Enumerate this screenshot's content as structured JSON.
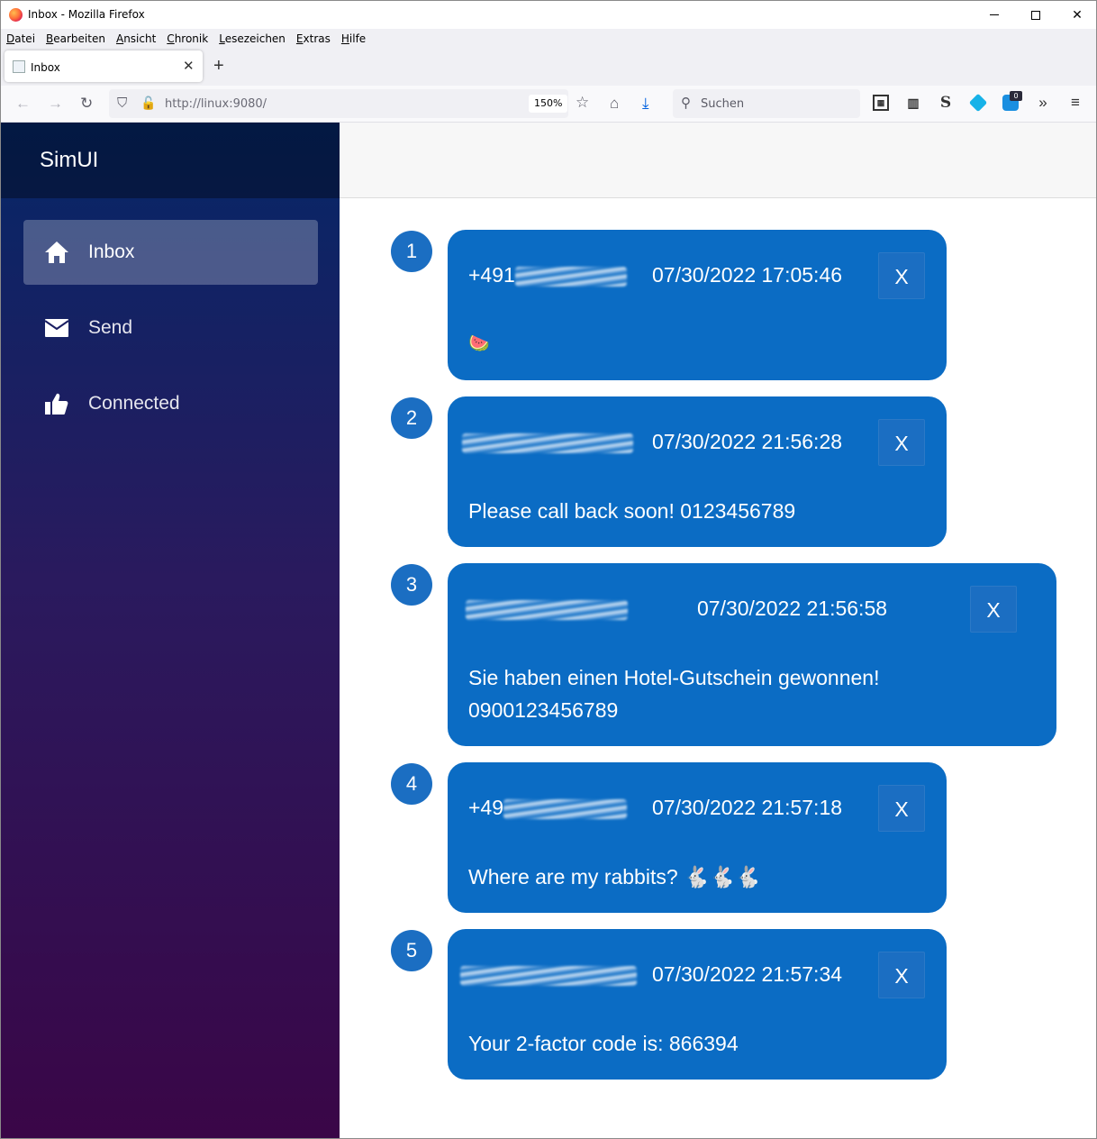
{
  "window": {
    "title": "Inbox - Mozilla Firefox"
  },
  "menu": [
    {
      "ul": "D",
      "rest": "atei"
    },
    {
      "ul": "B",
      "rest": "earbeiten"
    },
    {
      "ul": "A",
      "rest": "nsicht"
    },
    {
      "ul": "C",
      "rest": "hronik"
    },
    {
      "ul": "L",
      "rest": "esezeichen"
    },
    {
      "ul": "E",
      "rest": "xtras"
    },
    {
      "ul": "H",
      "rest": "ilfe"
    }
  ],
  "tab": {
    "label": "Inbox",
    "close": "✕",
    "new": "+"
  },
  "nav": {
    "url": "http://linux:9080/",
    "zoom": "150%",
    "search_placeholder": "Suchen",
    "ext_badge": "0"
  },
  "app": {
    "brand": "SimUI",
    "nav_items": [
      {
        "label": "Inbox",
        "icon": "home-icon",
        "active": true
      },
      {
        "label": "Send",
        "icon": "envelope-icon",
        "active": false
      },
      {
        "label": "Connected",
        "icon": "thumbs-up-icon",
        "active": false
      }
    ],
    "messages": [
      {
        "num": "1",
        "sender_prefix": "+491",
        "date": "07/30/2022 17:05:46",
        "close": "X",
        "lines": [
          "🍉"
        ]
      },
      {
        "num": "2",
        "sender_prefix": "",
        "date": "07/30/2022 21:56:28",
        "close": "X",
        "lines": [
          "Please call back soon! 0123456789"
        ]
      },
      {
        "num": "3",
        "sender_prefix": "",
        "date": "07/30/2022 21:56:58",
        "close": "X",
        "lines": [
          "Sie haben einen Hotel-Gutschein gewonnen!",
          "0900123456789"
        ]
      },
      {
        "num": "4",
        "sender_prefix": "+49",
        "date": "07/30/2022 21:57:18",
        "close": "X",
        "lines": [
          "Where are my rabbits? 🐇🐇🐇"
        ]
      },
      {
        "num": "5",
        "sender_prefix": "",
        "date": "07/30/2022 21:57:34",
        "close": "X",
        "lines": [
          "Your 2-factor code is: 866394"
        ]
      }
    ]
  }
}
